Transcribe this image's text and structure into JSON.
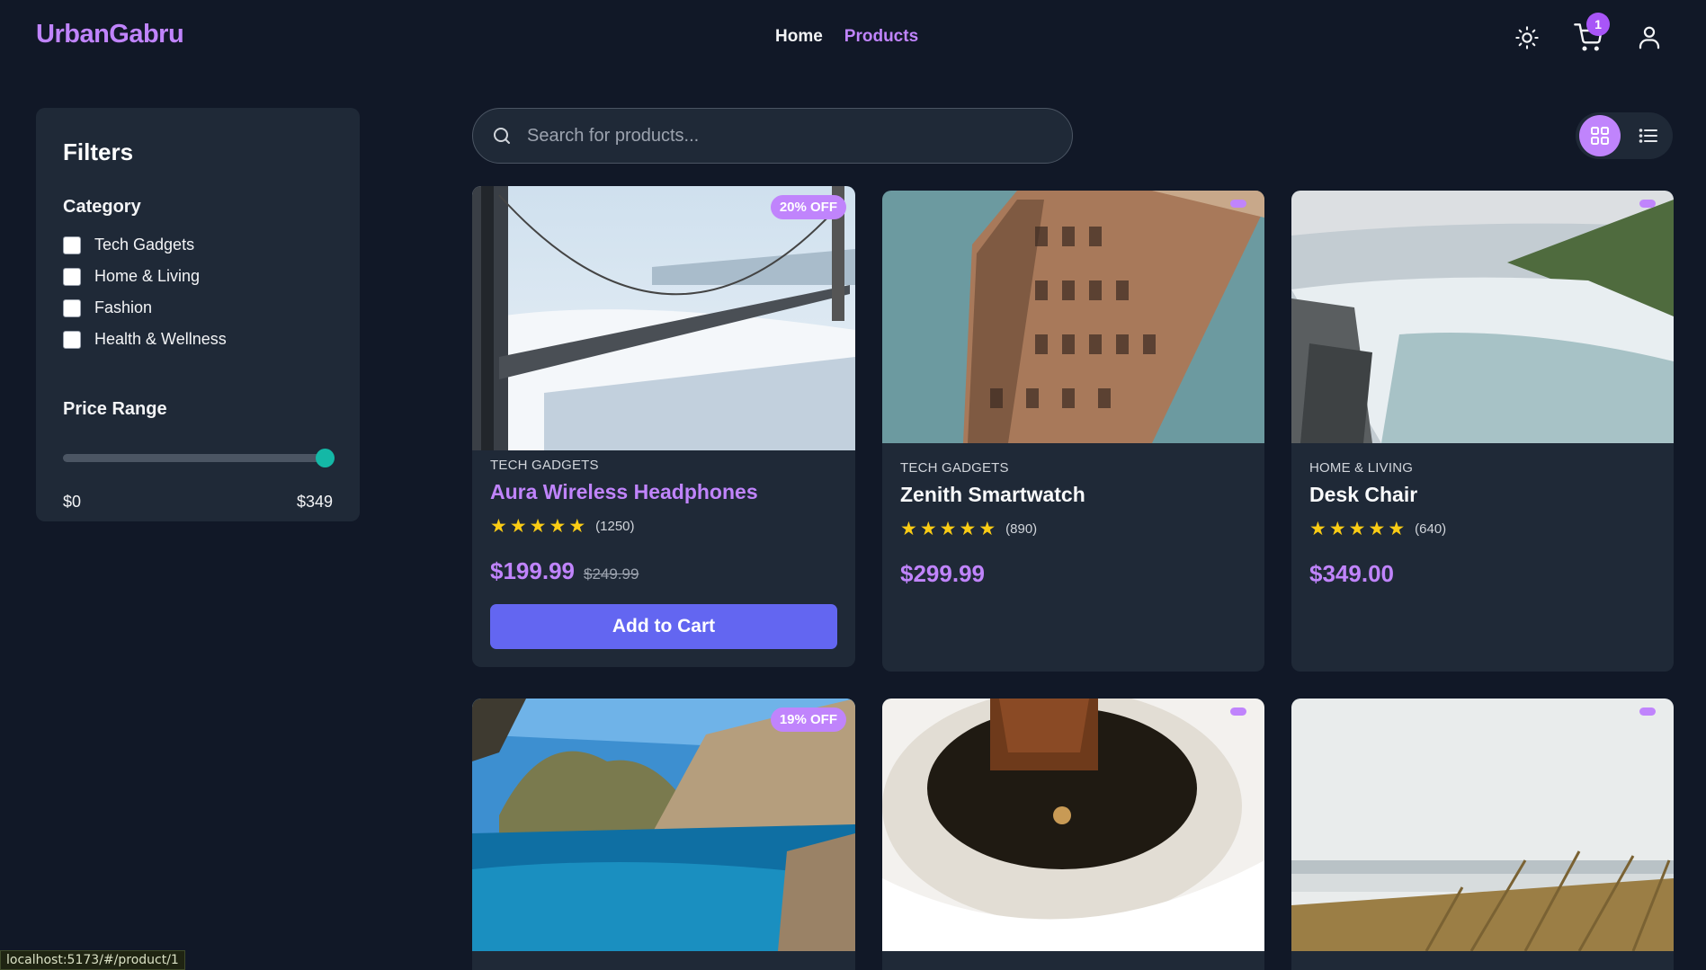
{
  "brand": "UrbanGabru",
  "nav": {
    "home": "Home",
    "products": "Products"
  },
  "header": {
    "cart_count": "1",
    "icons": [
      "sun-icon",
      "cart-icon",
      "user-icon"
    ]
  },
  "filters": {
    "title": "Filters",
    "category_title": "Category",
    "categories": [
      "Tech Gadgets",
      "Home & Living",
      "Fashion",
      "Health & Wellness"
    ],
    "price_title": "Price Range",
    "price_min": "$0",
    "price_max": "$349",
    "slider_value_fraction": 1.0
  },
  "search": {
    "placeholder": "Search for products..."
  },
  "view": {
    "active": "grid"
  },
  "products": [
    {
      "category": "Tech Gadgets",
      "title": "Aura Wireless Headphones",
      "rating_count": "(1250)",
      "price": "$199.99",
      "old_price": "$249.99",
      "badge": "20% OFF",
      "button": "Add to Cart",
      "stars": 5
    },
    {
      "category": "Tech Gadgets",
      "title": "Zenith Smartwatch",
      "rating_count": "(890)",
      "price": "$299.99",
      "stars": 5
    },
    {
      "category": "Home & Living",
      "title": "Desk Chair",
      "rating_count": "(640)",
      "price": "$349.00",
      "stars": 5
    },
    {
      "badge": "19% OFF"
    },
    {},
    {}
  ],
  "colors": {
    "accent": "#c084fc",
    "button": "#6366f1",
    "background": "#111827",
    "card": "#1f2937"
  },
  "status_url": "localhost:5173/#/product/1"
}
